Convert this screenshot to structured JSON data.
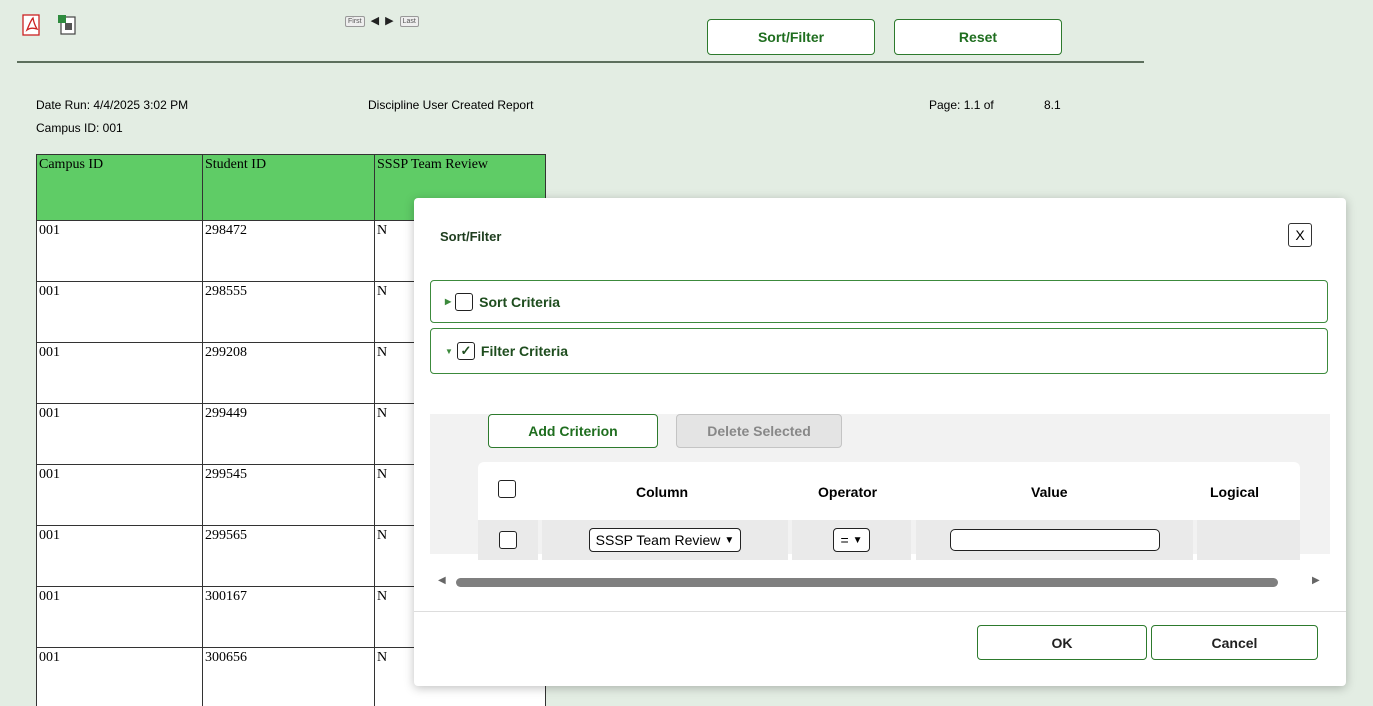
{
  "toolbar": {
    "pdf_icon": "pdf-icon",
    "export_icon": "export-icon",
    "pager_first": "First",
    "pager_last": "Last",
    "sort_filter_label": "Sort/Filter",
    "reset_label": "Reset"
  },
  "report": {
    "date_run": "Date Run: 4/4/2025 3:02 PM",
    "campus_line": "Campus ID: 001",
    "title": "Discipline User Created Report",
    "page_label": "Page: 1.1 of",
    "page_total": "8.1",
    "columns": [
      "Campus ID",
      "Student ID",
      "SSSP Team Review"
    ],
    "rows": [
      [
        "001",
        "298472",
        "N"
      ],
      [
        "001",
        "298555",
        "N"
      ],
      [
        "001",
        "299208",
        "N"
      ],
      [
        "001",
        "299449",
        "N"
      ],
      [
        "001",
        "299545",
        "N"
      ],
      [
        "001",
        "299565",
        "N"
      ],
      [
        "001",
        "300167",
        "N"
      ],
      [
        "001",
        "300656",
        "N"
      ]
    ]
  },
  "modal": {
    "title": "Sort/Filter",
    "close_label": "X",
    "sort_criteria": {
      "label": "Sort Criteria",
      "checked": false,
      "expanded": false
    },
    "filter_criteria": {
      "label": "Filter Criteria",
      "checked": true,
      "expanded": true
    },
    "add_criterion": "Add Criterion",
    "delete_selected": "Delete Selected",
    "grid_headers": {
      "column": "Column",
      "operator": "Operator",
      "value": "Value",
      "logical": "Logical"
    },
    "row": {
      "column_value": "SSSP Team Review",
      "operator_value": "=",
      "value": ""
    },
    "ok_label": "OK",
    "cancel_label": "Cancel"
  },
  "colors": {
    "accent": "#2d7a2d",
    "header_green": "#5fcc66",
    "page_bg": "#e3ede3"
  }
}
